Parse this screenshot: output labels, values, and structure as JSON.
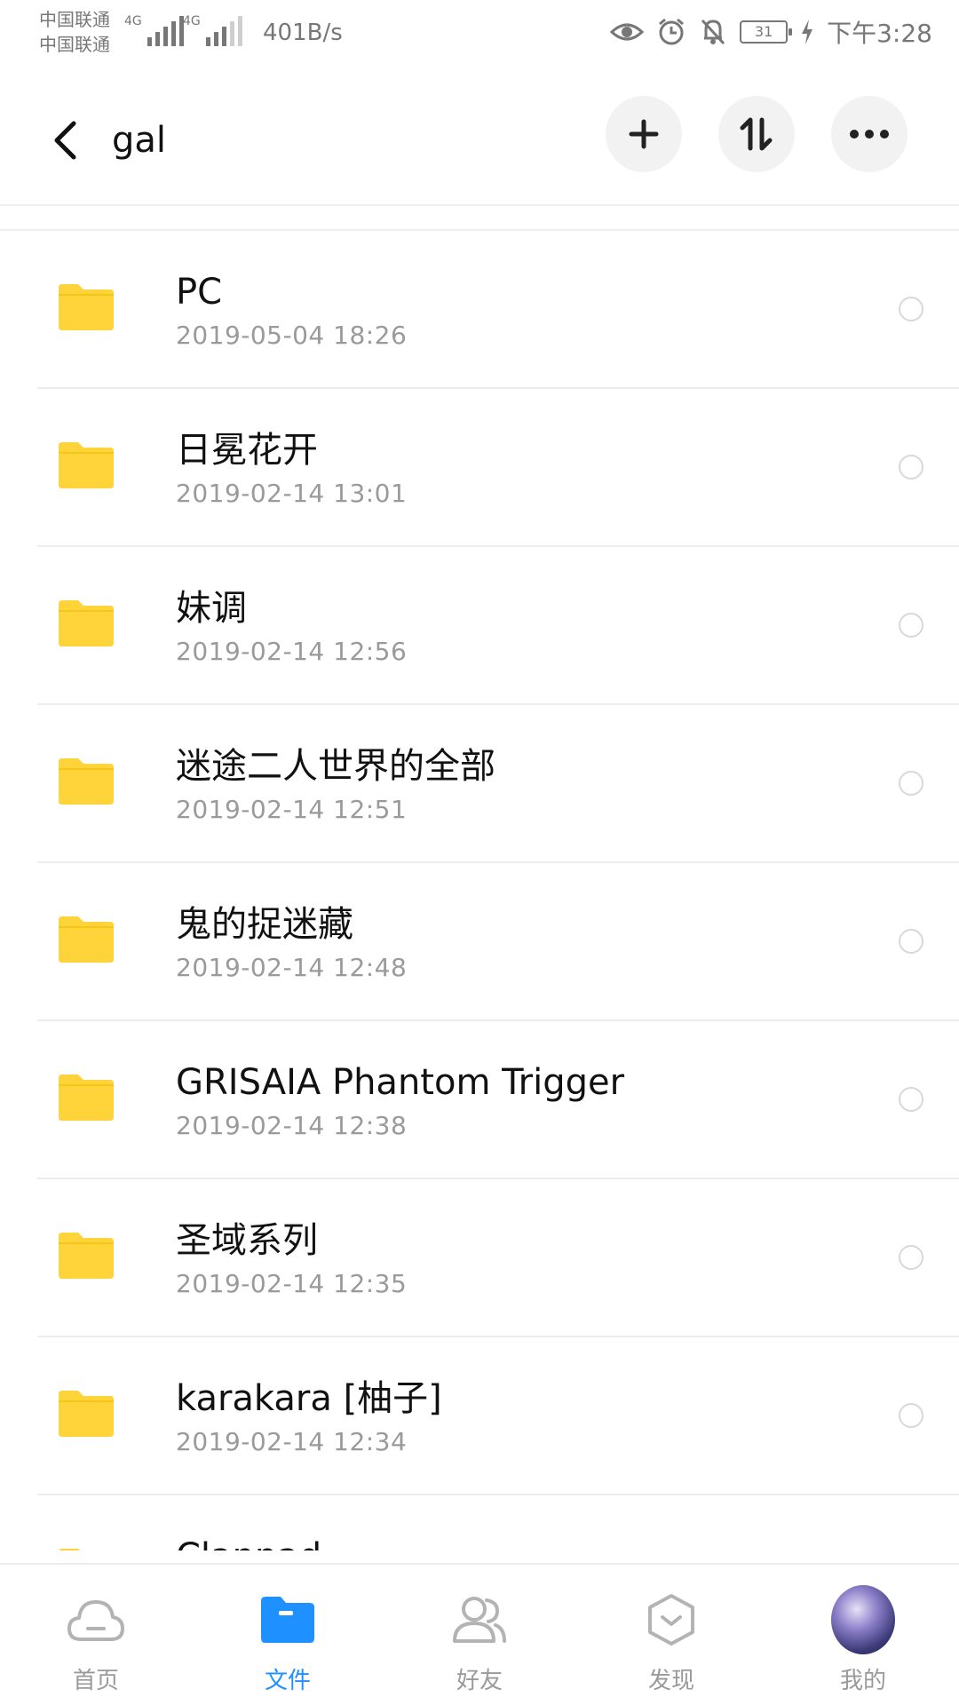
{
  "status_bar": {
    "carrier1": "中国联通",
    "carrier2": "中国联通",
    "sig1_label": "4G",
    "sig2_label": "4G",
    "net_speed": "401B/s",
    "battery": "31",
    "time": "下午3:28",
    "icons": [
      "eye-icon",
      "alarm-icon",
      "mute-bell-icon",
      "battery-icon",
      "charging-icon"
    ]
  },
  "header": {
    "title": "gal",
    "buttons": [
      "add-icon",
      "sort-icon",
      "more-icon"
    ]
  },
  "files": [
    {
      "name": "PC",
      "date": "2019-05-04  18:26"
    },
    {
      "name": "日冕花开",
      "date": "2019-02-14  13:01"
    },
    {
      "name": "妹调",
      "date": "2019-02-14  12:56"
    },
    {
      "name": "迷途二人世界的全部",
      "date": "2019-02-14  12:51"
    },
    {
      "name": "鬼的捉迷藏",
      "date": "2019-02-14  12:48"
    },
    {
      "name": "GRISAIA Phantom Trigger",
      "date": "2019-02-14  12:38"
    },
    {
      "name": "圣域系列",
      "date": "2019-02-14  12:35"
    },
    {
      "name": "karakara [柚子]",
      "date": "2019-02-14  12:34"
    },
    {
      "name": "Clannad",
      "date": ""
    }
  ],
  "nav": {
    "items": [
      {
        "label": "首页",
        "icon": "cloud-icon"
      },
      {
        "label": "文件",
        "icon": "folder-icon"
      },
      {
        "label": "好友",
        "icon": "friends-icon"
      },
      {
        "label": "发现",
        "icon": "discover-icon"
      },
      {
        "label": "我的",
        "icon": "avatar"
      }
    ],
    "active_index": 1
  },
  "colors": {
    "accent": "#1e90ff",
    "folder": "#ffd43b",
    "muted": "#9a9a9a"
  }
}
